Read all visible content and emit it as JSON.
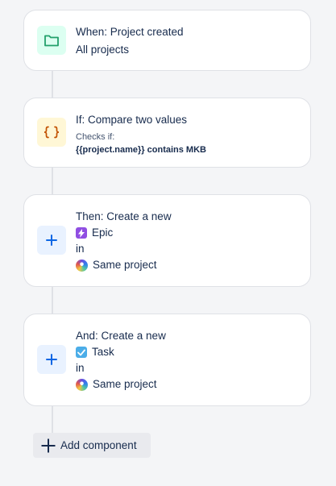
{
  "trigger": {
    "title": "When: Project created",
    "detail": "All projects",
    "icon": "folder-icon"
  },
  "condition": {
    "title": "If: Compare two values",
    "caption": "Checks if:",
    "expression": "{{project.name}} contains MKB",
    "icon": "curly-braces-icon"
  },
  "action_epic": {
    "title": "Then: Create a new",
    "issue_type": "Epic",
    "in_label": "in",
    "project": "Same project",
    "icon": "plus-icon",
    "issue_icon": "epic-lightning-icon"
  },
  "action_task": {
    "title": "And: Create a new",
    "issue_type": "Task",
    "in_label": "in",
    "project": "Same project",
    "icon": "plus-icon",
    "issue_icon": "task-check-icon"
  },
  "footer": {
    "add_component_label": "Add component"
  },
  "colors": {
    "trigger_bg": "#dcfff1",
    "trigger_icon": "#22a06b",
    "condition_bg": "#fff7d6",
    "condition_icon": "#c25100",
    "action_bg": "#e9f2ff",
    "action_icon": "#0c66e4",
    "epic": "#904ee2",
    "task": "#4bade8"
  }
}
